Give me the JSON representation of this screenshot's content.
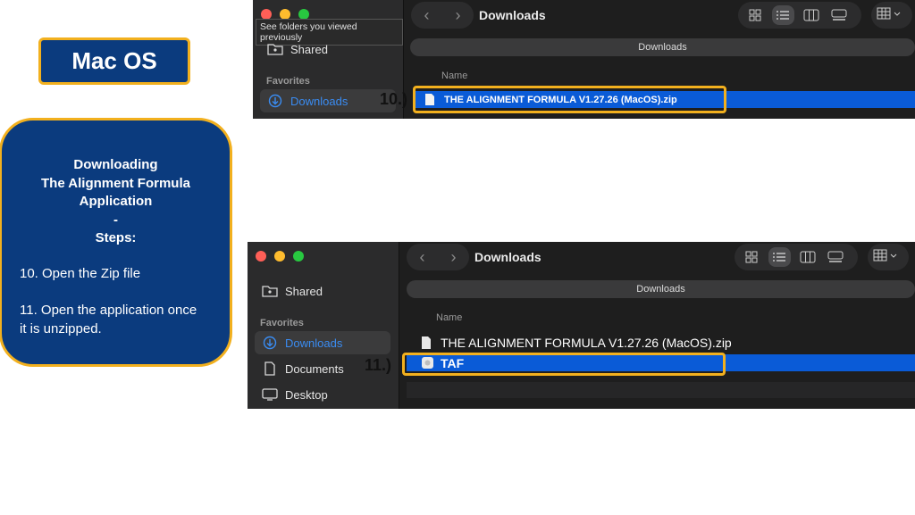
{
  "panel": {
    "title": "Mac OS",
    "heading_lines": [
      "Downloading",
      "The Alignment Formula",
      "Application",
      "-",
      "Steps:"
    ],
    "step10": "10. Open the Zip file",
    "step11": "11. Open the application once it is unzipped."
  },
  "finder1": {
    "tooltip": "See folders you viewed previously",
    "title": "Downloads",
    "path": "Downloads",
    "sidebar": {
      "shared": "Shared",
      "favorites": "Favorites",
      "downloads": "Downloads"
    },
    "column_name": "Name",
    "file": "THE ALIGNMENT FORMULA V1.27.26 (MacOS).zip",
    "step_label": "10.)"
  },
  "finder2": {
    "title": "Downloads",
    "path": "Downloads",
    "sidebar": {
      "shared": "Shared",
      "favorites": "Favorites",
      "downloads": "Downloads",
      "documents": "Documents",
      "desktop": "Desktop"
    },
    "column_name": "Name",
    "files": [
      "THE ALIGNMENT FORMULA V1.27.26 (MacOS).zip",
      "TAF"
    ],
    "step_label": "11.)"
  },
  "colors": {
    "panel_blue": "#0b3b7e",
    "accent_gold": "#f2b01e",
    "selection_blue": "#0a5bd7",
    "sidebar_accent": "#3a8cf2"
  },
  "icons": [
    "folder-shared-icon",
    "download-circle-icon",
    "document-icon",
    "desktop-icon",
    "chevron-left-icon",
    "chevron-right-icon",
    "grid-view-icon",
    "list-view-icon",
    "column-view-icon",
    "gallery-view-icon",
    "group-icon",
    "zip-file-icon",
    "app-icon"
  ]
}
